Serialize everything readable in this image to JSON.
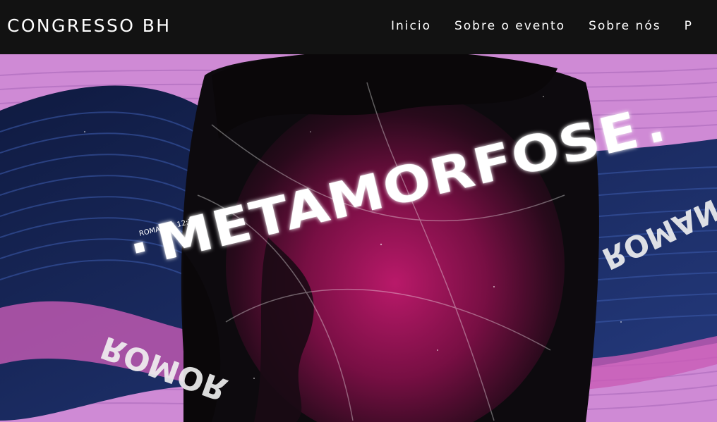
{
  "header": {
    "brand": "CONGRESSO BH",
    "nav": [
      {
        "label": "Inicio"
      },
      {
        "label": "Sobre o evento"
      },
      {
        "label": "Sobre nós"
      },
      {
        "label": "P"
      }
    ]
  },
  "hero": {
    "title": "METAMORFOSE",
    "title_suffix": ".",
    "title_prefix": "·",
    "verse": "ROMANOS 12:2",
    "ring_text_right": "ROMAN",
    "ring_text_left": "ROMOR",
    "colors": {
      "pink": "#d28ad6",
      "navy": "#1a2a5e",
      "magenta": "#b0135f",
      "dark": "#0d0a0e"
    }
  }
}
